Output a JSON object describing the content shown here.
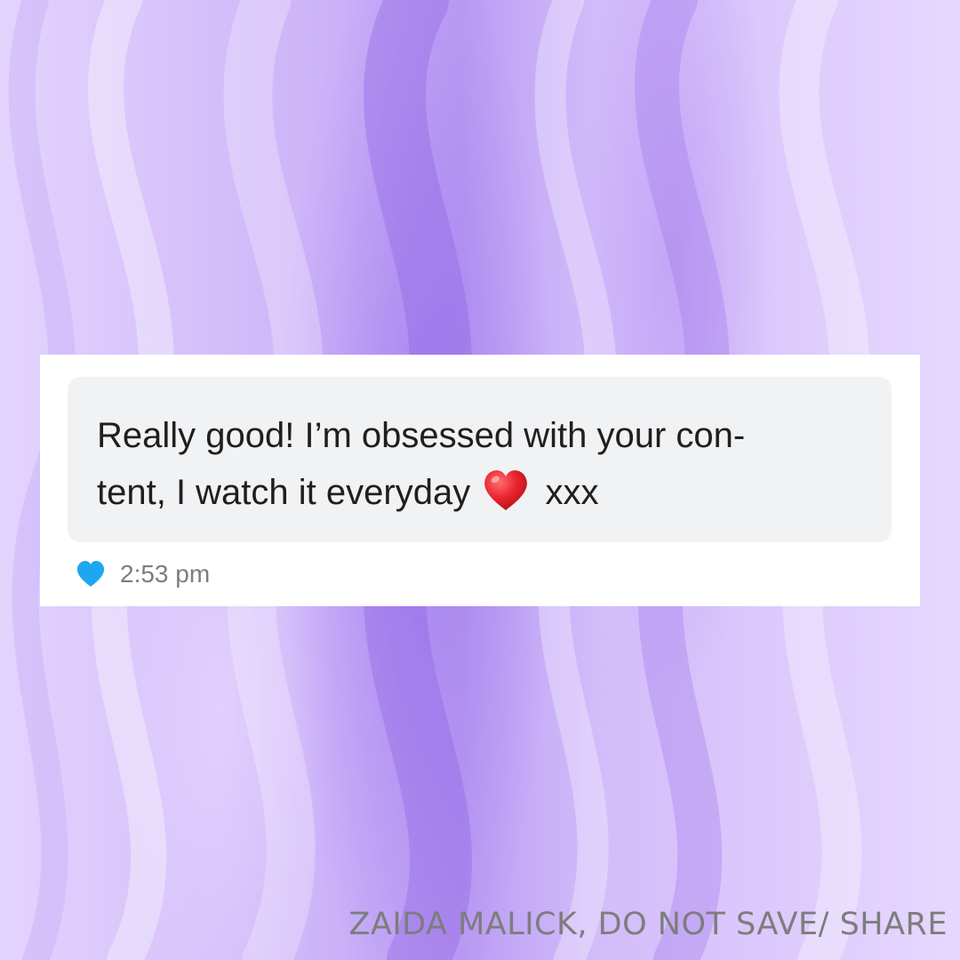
{
  "message": {
    "line1": "Really good! I’m obsessed with your con-",
    "line2_before": "tent, I watch it everyday",
    "emoji": "red-heart-emoji",
    "line2_after": "xxx",
    "liked": true,
    "like_icon": "blue-heart-icon",
    "timestamp": "2:53 pm"
  },
  "watermark": "ZAIDA MALICK, DO NOT SAVE/ SHARE",
  "colors": {
    "background": "#d9c6fb",
    "card": "#ffffff",
    "bubble": "#f1f2f4",
    "text": "#1f1f1f",
    "timestamp": "#7a7d84",
    "like": "#1ea7f0",
    "emoji_heart": "#e8232d",
    "watermark": "#7d7d7d"
  }
}
